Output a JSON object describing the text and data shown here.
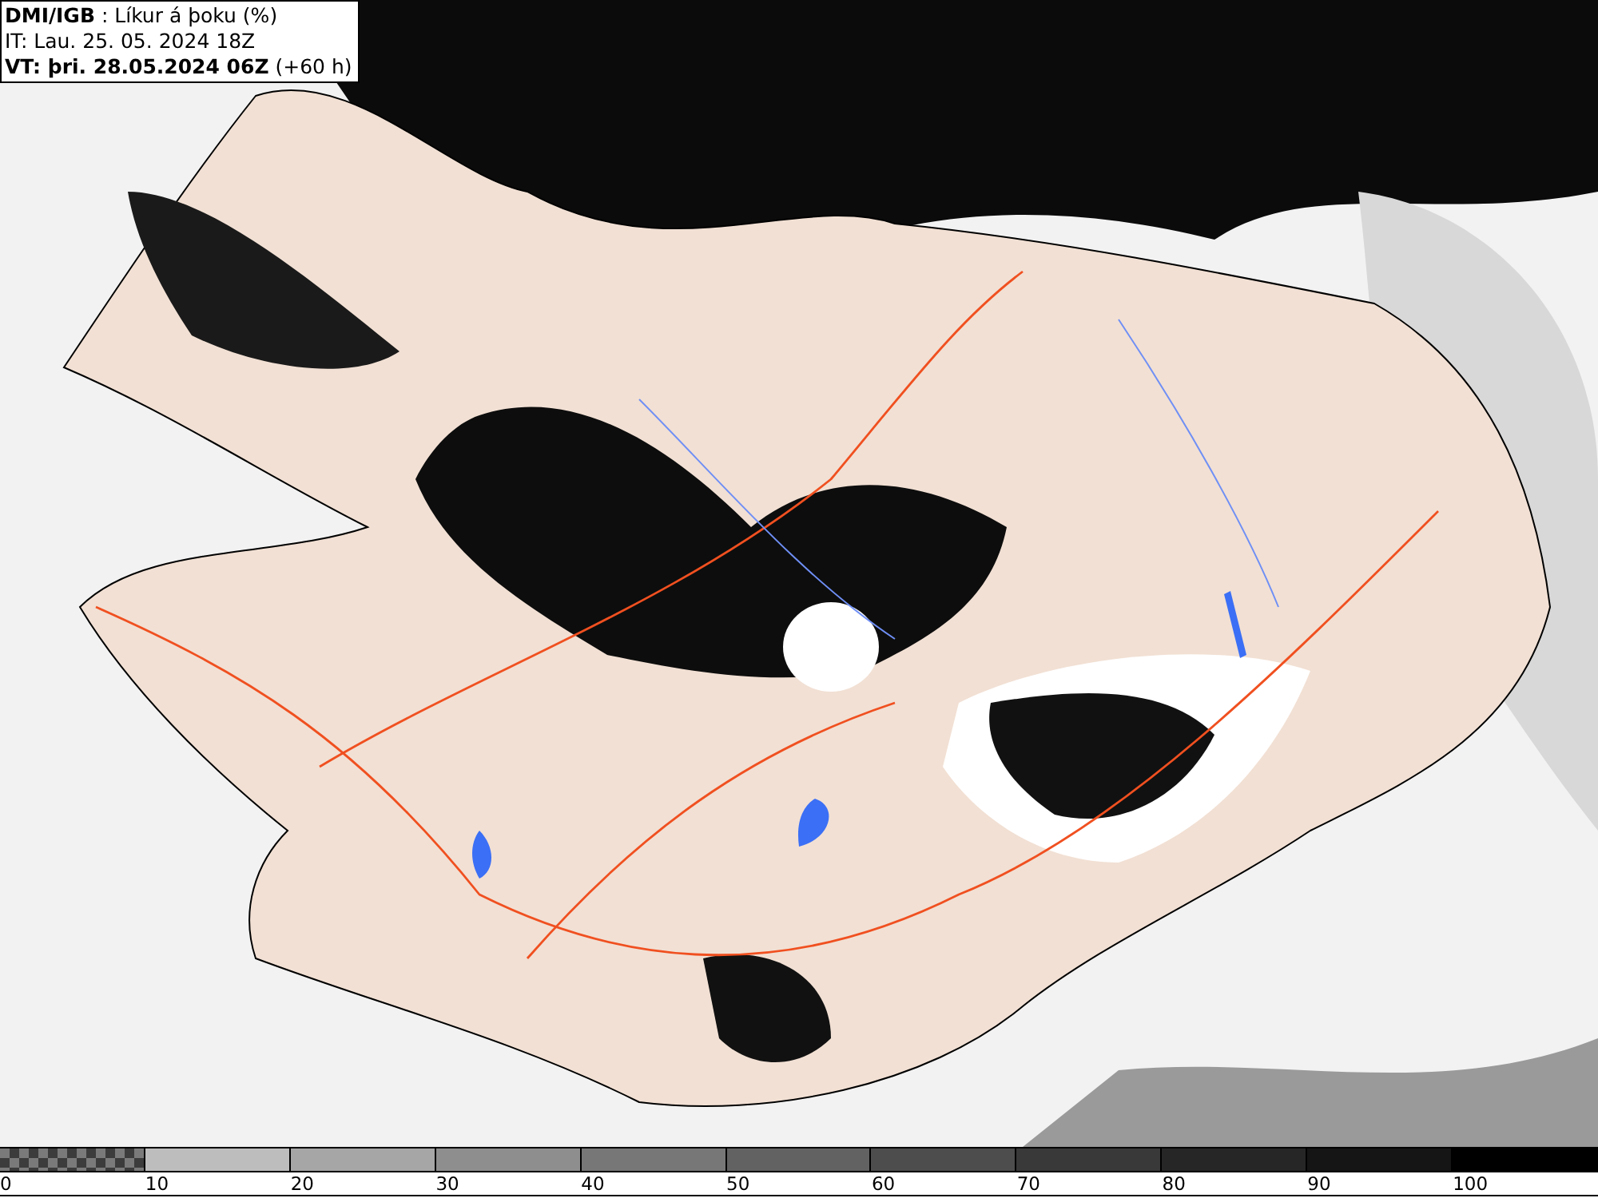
{
  "header": {
    "lines": [
      "**DMI/IGB** : Líkur á þoku (%)",
      "IT: Lau. 25. 05. 2024 18Z",
      "**VT: þri. 28.05.2024 06Z** (+60 h)"
    ]
  },
  "legend": {
    "bins": [
      {
        "kind": "checker",
        "label": "0"
      },
      {
        "kind": "solid",
        "label": "10",
        "color": "#bdbdbd"
      },
      {
        "kind": "solid",
        "label": "20",
        "color": "#a6a6a6"
      },
      {
        "kind": "solid",
        "label": "30",
        "color": "#8e8e8e"
      },
      {
        "kind": "solid",
        "label": "40",
        "color": "#777777"
      },
      {
        "kind": "solid",
        "label": "50",
        "color": "#626262"
      },
      {
        "kind": "solid",
        "label": "60",
        "color": "#4d4d4d"
      },
      {
        "kind": "solid",
        "label": "70",
        "color": "#393939"
      },
      {
        "kind": "solid",
        "label": "80",
        "color": "#262626"
      },
      {
        "kind": "solid",
        "label": "90",
        "color": "#151515"
      },
      {
        "kind": "solid",
        "label": "100",
        "color": "#000000"
      }
    ]
  }
}
